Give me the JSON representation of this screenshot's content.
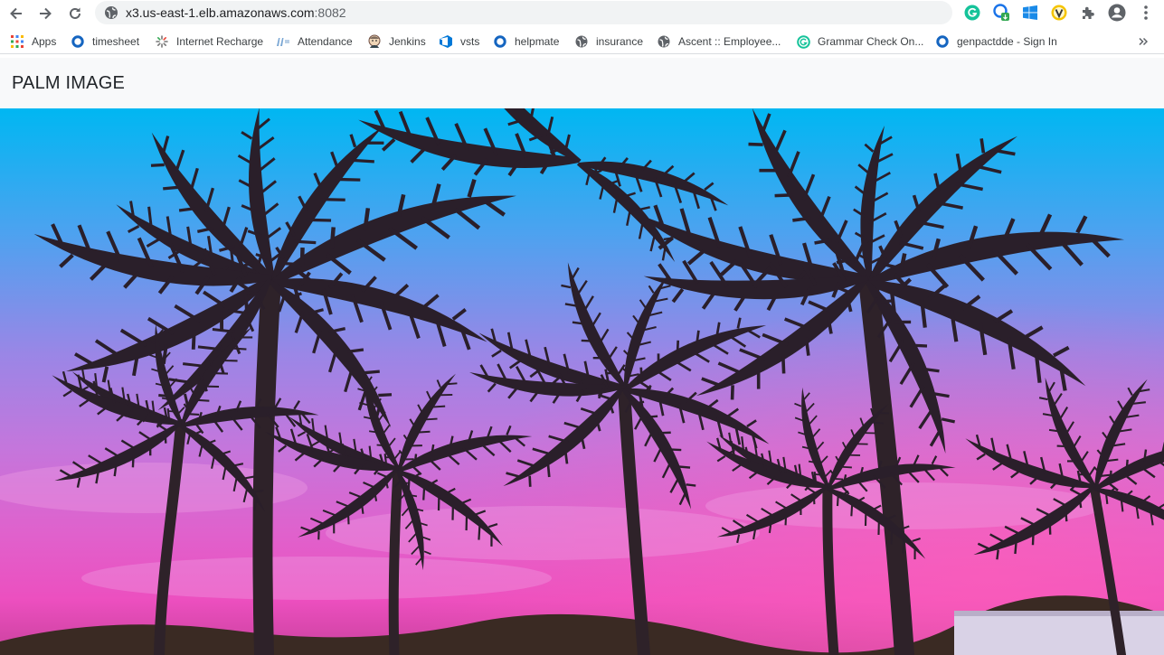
{
  "browser": {
    "url_host": "x3.us-east-1.elb.amazonaws.com",
    "url_port": ":8082",
    "extensions": [
      "grammarly-icon",
      "extension-update-icon",
      "windows-icon",
      "v-extension-icon",
      "puzzle-icon",
      "profile-icon",
      "kebab-menu-icon"
    ]
  },
  "bookmarks": [
    {
      "label": "Apps",
      "icon": "apps-grid-icon"
    },
    {
      "label": "timesheet",
      "icon": "blue-ring-icon"
    },
    {
      "label": "Internet Recharge",
      "icon": "spinner-icon"
    },
    {
      "label": "Attendance",
      "icon": "attendance-icon"
    },
    {
      "label": "Jenkins",
      "icon": "jenkins-icon"
    },
    {
      "label": "vsts",
      "icon": "vsts-icon"
    },
    {
      "label": "helpmate",
      "icon": "blue-ring-icon"
    },
    {
      "label": "insurance",
      "icon": "globe-icon"
    },
    {
      "label": "Ascent :: Employee...",
      "icon": "globe-icon"
    },
    {
      "label": "Grammar Check On...",
      "icon": "grammar-g-icon"
    },
    {
      "label": "genpactdde - Sign In",
      "icon": "blue-ring-icon"
    }
  ],
  "page": {
    "brand": "PALM IMAGE"
  },
  "colors": {
    "sky_top": "#00b7f2",
    "sky_mid": "#9a86e6",
    "sky_low": "#d86bd6",
    "horizon": "#ec4fbf",
    "palm": "#2a1f2a"
  }
}
